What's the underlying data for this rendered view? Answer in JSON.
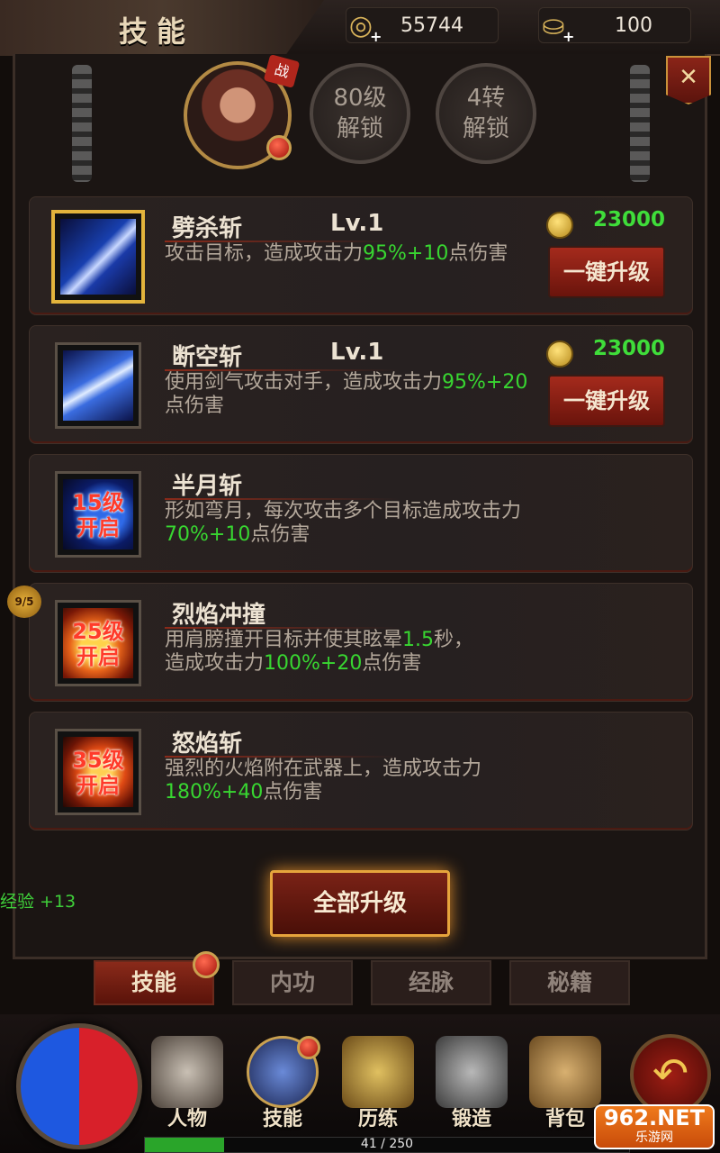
{
  "header": {
    "title": "技能",
    "coins": "55744",
    "ingots": "100"
  },
  "top": {
    "avatar_tag": "战",
    "lock1": [
      "80级",
      "解锁"
    ],
    "lock2": [
      "4转",
      "解锁"
    ],
    "close": "✕"
  },
  "skills": [
    {
      "name": "劈杀斩",
      "level": "Lv.1",
      "desc_a": "攻击目标，造成攻击力",
      "desc_g": "95%+10",
      "desc_b": "点伤害",
      "cost": "23000",
      "button": "一键升级"
    },
    {
      "name": "断空斩",
      "level": "Lv.1",
      "desc_a": "使用剑气攻击对手，造成攻击力",
      "desc_g": "95%+20",
      "desc_b": "点伤害",
      "cost": "23000",
      "button": "一键升级"
    },
    {
      "name": "半月斩",
      "lock": [
        "15级",
        "开启"
      ],
      "desc_a": "形如弯月，每次攻击多个目标造成攻击力",
      "desc_g": "70%+10",
      "desc_b": "点伤害"
    },
    {
      "name": "烈焰冲撞",
      "lock": [
        "25级",
        "开启"
      ],
      "desc_a": "用肩膀撞开目标并使其眩晕",
      "desc_g": "1.5",
      "desc_b": "秒，",
      "desc_a2": "造成攻击力",
      "desc_g2": "100%+20",
      "desc_b2": "点伤害"
    },
    {
      "name": "怒焰斩",
      "lock": [
        "35级",
        "开启"
      ],
      "desc_a": "强烈的火焰附在武器上，造成攻击力",
      "desc_g": "180%+40",
      "desc_b": "点伤害"
    }
  ],
  "side_badge": "9/5",
  "exp_gain": "经验 +13",
  "upgrade_all": "全部升级",
  "tabs": [
    "技能",
    "内功",
    "经脉",
    "秘籍"
  ],
  "nav": [
    "人物",
    "技能",
    "历练",
    "锻造",
    "背包"
  ],
  "back_label": "返回",
  "xp": {
    "text": "41 / 250",
    "progress": 0.164
  },
  "watermark": {
    "line1": "962.NET",
    "line2": "乐游网"
  },
  "colors": {
    "accent": "#e3b43c",
    "highlight_green": "#38d631",
    "button_red": "#a42a1c"
  }
}
